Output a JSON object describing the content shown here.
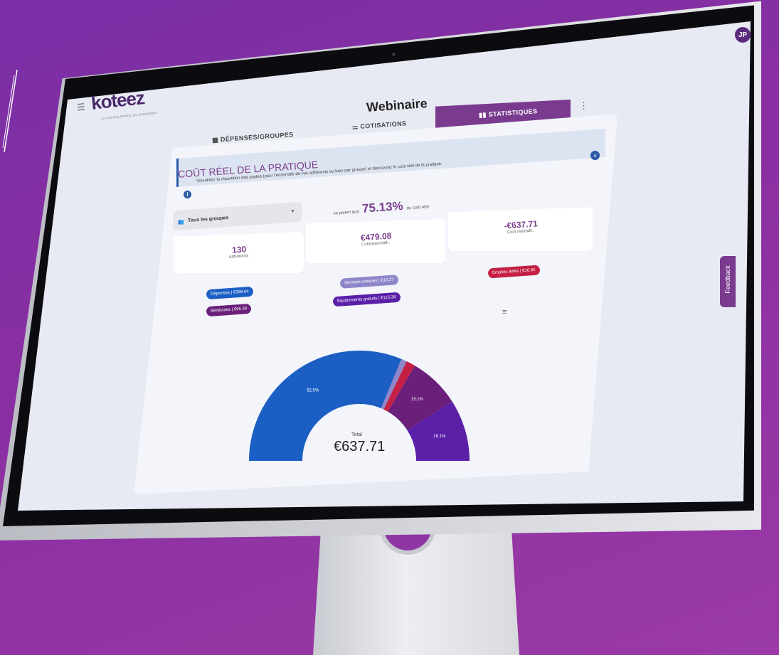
{
  "app": {
    "logo_text": "koteez",
    "logo_tagline": "LA CALCULATRICE DU DIRIGEANT",
    "page_title": "Webinaire",
    "avatar_initials": "JP",
    "feedback_label": "Feedback"
  },
  "tabs": [
    {
      "label": "DÉPENSES/GROUPES",
      "icon": "calculator-icon",
      "active": false
    },
    {
      "label": "COTISATIONS",
      "icon": "sliders-icon",
      "active": false
    },
    {
      "label": "STATISTIQUES",
      "icon": "bar-chart-icon",
      "active": true
    }
  ],
  "section": {
    "title": "COÛT RÉEL DE LA PRATIQUE",
    "info_text": "Visualisez la répartition des postes (pour l'ensemble de vos adhérents ou bien par groupe) et découvrez le coût réel de la pratique."
  },
  "group_select": {
    "value": "Tous les groupes"
  },
  "payment": {
    "prefix": "ne paient que",
    "percent": "75.13%",
    "suffix": "du coût réel"
  },
  "stats": {
    "adherents_value": "130",
    "adherents_label": "Adhérents",
    "cotisation_value": "€479.08",
    "cotisation_label": "Cotisation/adh.",
    "cout_value": "-€637.71",
    "cout_label": "Coût réel/adh."
  },
  "pills": {
    "depenses": "Dépenses | €398.64",
    "benevoles": "Bénévoles | €96.39",
    "services": "Services civiques | €10.37",
    "equipements": "Équipements gratuits | €115.38",
    "emplois": "Emplois aidés | €16.92"
  },
  "chart_data": {
    "type": "pie",
    "subtype": "half-donut",
    "series": [
      {
        "name": "Dépenses",
        "value": 398.64,
        "label": "62.5%",
        "color": "#1b5fc4"
      },
      {
        "name": "Services civiques",
        "value": 10.37,
        "label": "",
        "color": "#8e86c9"
      },
      {
        "name": "Emplois aidés",
        "value": 16.92,
        "label": "",
        "color": "#c41f44"
      },
      {
        "name": "Bénévoles",
        "value": 96.39,
        "label": "15.1%",
        "color": "#6a1f7a"
      },
      {
        "name": "Équipements gratuits",
        "value": 115.38,
        "label": "18.1%",
        "color": "#5b1fa8"
      }
    ],
    "total_label": "Total",
    "total_value": "€637.71"
  }
}
